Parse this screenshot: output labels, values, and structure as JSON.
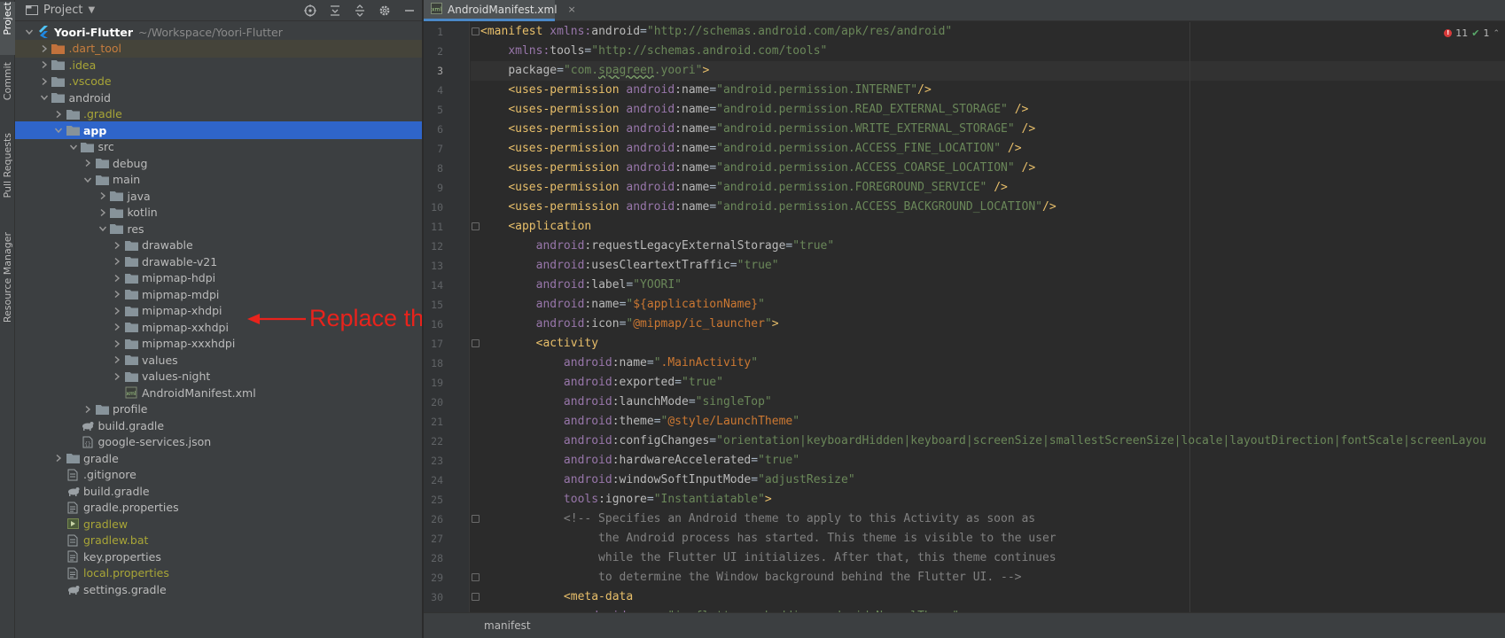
{
  "tool_strip": {
    "tabs": [
      {
        "label": "Project",
        "active": true
      },
      {
        "label": "Commit",
        "active": false
      },
      {
        "label": "Pull Requests",
        "active": false
      },
      {
        "label": "Resource Manager",
        "active": false
      }
    ]
  },
  "project_panel": {
    "title": "Project",
    "tools": [
      "locate-icon",
      "expand-all-icon",
      "collapse-all-icon",
      "settings-icon",
      "hide-icon"
    ],
    "tree": [
      {
        "label": "Yoori-Flutter",
        "sub": "~/Workspace/Yoori-Flutter",
        "depth": 0,
        "arrow": "down",
        "icon": "flutter-module-icon",
        "style": "bold"
      },
      {
        "label": ".dart_tool",
        "depth": 1,
        "arrow": "right",
        "icon": "excluded-folder-icon",
        "style": "orange",
        "dim": true
      },
      {
        "label": ".idea",
        "depth": 1,
        "arrow": "right",
        "icon": "folder-icon",
        "style": "olive"
      },
      {
        "label": ".vscode",
        "depth": 1,
        "arrow": "right",
        "icon": "folder-icon",
        "style": "olive"
      },
      {
        "label": "android",
        "depth": 1,
        "arrow": "down",
        "icon": "folder-icon",
        "style": "normal"
      },
      {
        "label": ".gradle",
        "depth": 2,
        "arrow": "right",
        "icon": "folder-icon",
        "style": "olive"
      },
      {
        "label": "app",
        "depth": 2,
        "arrow": "down",
        "icon": "folder-icon",
        "style": "normal",
        "selected": true
      },
      {
        "label": "src",
        "depth": 3,
        "arrow": "down",
        "icon": "folder-icon",
        "style": "normal"
      },
      {
        "label": "debug",
        "depth": 4,
        "arrow": "right",
        "icon": "folder-icon",
        "style": "normal"
      },
      {
        "label": "main",
        "depth": 4,
        "arrow": "down",
        "icon": "folder-icon",
        "style": "normal"
      },
      {
        "label": "java",
        "depth": 5,
        "arrow": "right",
        "icon": "folder-icon",
        "style": "normal"
      },
      {
        "label": "kotlin",
        "depth": 5,
        "arrow": "right",
        "icon": "folder-icon",
        "style": "normal"
      },
      {
        "label": "res",
        "depth": 5,
        "arrow": "down",
        "icon": "folder-icon",
        "style": "normal"
      },
      {
        "label": "drawable",
        "depth": 6,
        "arrow": "right",
        "icon": "folder-icon",
        "style": "normal"
      },
      {
        "label": "drawable-v21",
        "depth": 6,
        "arrow": "right",
        "icon": "folder-icon",
        "style": "normal"
      },
      {
        "label": "mipmap-hdpi",
        "depth": 6,
        "arrow": "right",
        "icon": "folder-icon",
        "style": "normal"
      },
      {
        "label": "mipmap-mdpi",
        "depth": 6,
        "arrow": "right",
        "icon": "folder-icon",
        "style": "normal"
      },
      {
        "label": "mipmap-xhdpi",
        "depth": 6,
        "arrow": "right",
        "icon": "folder-icon",
        "style": "normal"
      },
      {
        "label": "mipmap-xxhdpi",
        "depth": 6,
        "arrow": "right",
        "icon": "folder-icon",
        "style": "normal"
      },
      {
        "label": "mipmap-xxxhdpi",
        "depth": 6,
        "arrow": "right",
        "icon": "folder-icon",
        "style": "normal"
      },
      {
        "label": "values",
        "depth": 6,
        "arrow": "right",
        "icon": "folder-icon",
        "style": "normal"
      },
      {
        "label": "values-night",
        "depth": 6,
        "arrow": "right",
        "icon": "folder-icon",
        "style": "normal"
      },
      {
        "label": "AndroidManifest.xml",
        "depth": 6,
        "arrow": "none",
        "icon": "xml-file-icon",
        "style": "normal"
      },
      {
        "label": "profile",
        "depth": 4,
        "arrow": "right",
        "icon": "folder-icon",
        "style": "normal"
      },
      {
        "label": "build.gradle",
        "depth": 3,
        "arrow": "none",
        "icon": "gradle-file-icon",
        "style": "normal"
      },
      {
        "label": "google-services.json",
        "depth": 3,
        "arrow": "none",
        "icon": "json-file-icon",
        "style": "normal"
      },
      {
        "label": "gradle",
        "depth": 2,
        "arrow": "right",
        "icon": "folder-icon",
        "style": "normal"
      },
      {
        "label": ".gitignore",
        "depth": 2,
        "arrow": "none",
        "icon": "text-file-icon",
        "style": "normal"
      },
      {
        "label": "build.gradle",
        "depth": 2,
        "arrow": "none",
        "icon": "gradle-file-icon",
        "style": "normal"
      },
      {
        "label": "gradle.properties",
        "depth": 2,
        "arrow": "none",
        "icon": "properties-file-icon",
        "style": "normal"
      },
      {
        "label": "gradlew",
        "depth": 2,
        "arrow": "none",
        "icon": "script-file-icon",
        "style": "olive"
      },
      {
        "label": "gradlew.bat",
        "depth": 2,
        "arrow": "none",
        "icon": "text-file-icon",
        "style": "olive"
      },
      {
        "label": "key.properties",
        "depth": 2,
        "arrow": "none",
        "icon": "properties-file-icon",
        "style": "normal"
      },
      {
        "label": "local.properties",
        "depth": 2,
        "arrow": "none",
        "icon": "properties-file-icon",
        "style": "olive"
      },
      {
        "label": "settings.gradle",
        "depth": 2,
        "arrow": "none",
        "icon": "gradle-file-icon",
        "style": "normal"
      }
    ]
  },
  "annotation": {
    "text": "Replace these filese",
    "color": "#e8231c"
  },
  "editor": {
    "tab": {
      "name": "AndroidManifest.xml",
      "close": "×"
    },
    "inspections": {
      "errors": "11",
      "ok": "1"
    },
    "current_line": 3,
    "breadcrumb": "manifest",
    "lines": [
      {
        "n": 1,
        "fold": true,
        "tokens": [
          [
            "t-tag",
            "<manifest "
          ],
          [
            "t-ns",
            "xmlns:"
          ],
          [
            "t-attr",
            "android"
          ],
          [
            "t-plain",
            "="
          ],
          [
            "t-val",
            "\"http://schemas.android.com/apk/res/android\""
          ]
        ]
      },
      {
        "n": 2,
        "tokens": [
          [
            "t-plain",
            "    "
          ],
          [
            "t-ns",
            "xmlns:"
          ],
          [
            "t-attr",
            "tools"
          ],
          [
            "t-plain",
            "="
          ],
          [
            "t-val",
            "\"http://schemas.android.com/tools\""
          ]
        ]
      },
      {
        "n": 3,
        "tokens": [
          [
            "t-plain",
            "    "
          ],
          [
            "t-attr",
            "package"
          ],
          [
            "t-plain",
            "="
          ],
          [
            "t-val",
            "\"com."
          ],
          [
            "t-val squig",
            "spagreen"
          ],
          [
            "t-val",
            ".yoori\""
          ],
          [
            "t-tag",
            ">"
          ]
        ]
      },
      {
        "n": 4,
        "tokens": [
          [
            "t-plain",
            "    "
          ],
          [
            "t-tag",
            "<uses-permission "
          ],
          [
            "t-ns",
            "android"
          ],
          [
            "t-attr",
            ":name"
          ],
          [
            "t-plain",
            "="
          ],
          [
            "t-val",
            "\"android.permission.INTERNET\""
          ],
          [
            "t-tag",
            "/>"
          ]
        ]
      },
      {
        "n": 5,
        "tokens": [
          [
            "t-plain",
            "    "
          ],
          [
            "t-tag",
            "<uses-permission "
          ],
          [
            "t-ns",
            "android"
          ],
          [
            "t-attr",
            ":name"
          ],
          [
            "t-plain",
            "="
          ],
          [
            "t-val",
            "\"android.permission.READ_EXTERNAL_STORAGE\""
          ],
          [
            "t-tag",
            " />"
          ]
        ]
      },
      {
        "n": 6,
        "tokens": [
          [
            "t-plain",
            "    "
          ],
          [
            "t-tag",
            "<uses-permission "
          ],
          [
            "t-ns",
            "android"
          ],
          [
            "t-attr",
            ":name"
          ],
          [
            "t-plain",
            "="
          ],
          [
            "t-val",
            "\"android.permission.WRITE_EXTERNAL_STORAGE\""
          ],
          [
            "t-tag",
            " />"
          ]
        ]
      },
      {
        "n": 7,
        "tokens": [
          [
            "t-plain",
            "    "
          ],
          [
            "t-tag",
            "<uses-permission "
          ],
          [
            "t-ns",
            "android"
          ],
          [
            "t-attr",
            ":name"
          ],
          [
            "t-plain",
            "="
          ],
          [
            "t-val",
            "\"android.permission.ACCESS_FINE_LOCATION\""
          ],
          [
            "t-tag",
            " />"
          ]
        ]
      },
      {
        "n": 8,
        "tokens": [
          [
            "t-plain",
            "    "
          ],
          [
            "t-tag",
            "<uses-permission "
          ],
          [
            "t-ns",
            "android"
          ],
          [
            "t-attr",
            ":name"
          ],
          [
            "t-plain",
            "="
          ],
          [
            "t-val",
            "\"android.permission.ACCESS_COARSE_LOCATION\""
          ],
          [
            "t-tag",
            " />"
          ]
        ]
      },
      {
        "n": 9,
        "tokens": [
          [
            "t-plain",
            "    "
          ],
          [
            "t-tag",
            "<uses-permission "
          ],
          [
            "t-ns",
            "android"
          ],
          [
            "t-attr",
            ":name"
          ],
          [
            "t-plain",
            "="
          ],
          [
            "t-val",
            "\"android.permission.FOREGROUND_SERVICE\""
          ],
          [
            "t-tag",
            " />"
          ]
        ]
      },
      {
        "n": 10,
        "tokens": [
          [
            "t-plain",
            "    "
          ],
          [
            "t-tag",
            "<uses-permission "
          ],
          [
            "t-ns",
            "android"
          ],
          [
            "t-attr",
            ":name"
          ],
          [
            "t-plain",
            "="
          ],
          [
            "t-val",
            "\"android.permission.ACCESS_BACKGROUND_LOCATION\""
          ],
          [
            "t-tag",
            "/>"
          ]
        ]
      },
      {
        "n": 11,
        "fold": true,
        "tokens": [
          [
            "t-plain",
            "    "
          ],
          [
            "t-tag",
            "<application"
          ]
        ]
      },
      {
        "n": 12,
        "tokens": [
          [
            "t-plain",
            "        "
          ],
          [
            "t-ns",
            "android"
          ],
          [
            "t-attr",
            ":requestLegacyExternalStorage"
          ],
          [
            "t-plain",
            "="
          ],
          [
            "t-val",
            "\"true\""
          ]
        ]
      },
      {
        "n": 13,
        "tokens": [
          [
            "t-plain",
            "        "
          ],
          [
            "t-ns",
            "android"
          ],
          [
            "t-attr",
            ":usesCleartextTraffic"
          ],
          [
            "t-plain",
            "="
          ],
          [
            "t-val",
            "\"true\""
          ]
        ]
      },
      {
        "n": 14,
        "tokens": [
          [
            "t-plain",
            "        "
          ],
          [
            "t-ns",
            "android"
          ],
          [
            "t-attr",
            ":label"
          ],
          [
            "t-plain",
            "="
          ],
          [
            "t-val",
            "\"YOORI\""
          ]
        ]
      },
      {
        "n": 15,
        "tokens": [
          [
            "t-plain",
            "        "
          ],
          [
            "t-ns",
            "android"
          ],
          [
            "t-attr",
            ":name"
          ],
          [
            "t-plain",
            "="
          ],
          [
            "t-val",
            "\""
          ],
          [
            "t-ref",
            "${applicationName}"
          ],
          [
            "t-val",
            "\""
          ]
        ]
      },
      {
        "n": 16,
        "tokens": [
          [
            "t-plain",
            "        "
          ],
          [
            "t-ns",
            "android"
          ],
          [
            "t-attr",
            ":icon"
          ],
          [
            "t-plain",
            "="
          ],
          [
            "t-val",
            "\""
          ],
          [
            "t-ref",
            "@mipmap/ic_launcher"
          ],
          [
            "t-val",
            "\""
          ],
          [
            "t-tag",
            ">"
          ]
        ]
      },
      {
        "n": 17,
        "fold": true,
        "tokens": [
          [
            "t-plain",
            "        "
          ],
          [
            "t-tag",
            "<activity"
          ]
        ]
      },
      {
        "n": 18,
        "tokens": [
          [
            "t-plain",
            "            "
          ],
          [
            "t-ns",
            "android"
          ],
          [
            "t-attr",
            ":name"
          ],
          [
            "t-plain",
            "="
          ],
          [
            "t-val",
            "\""
          ],
          [
            "t-ref",
            ".MainActivity"
          ],
          [
            "t-val",
            "\""
          ]
        ]
      },
      {
        "n": 19,
        "tokens": [
          [
            "t-plain",
            "            "
          ],
          [
            "t-ns",
            "android"
          ],
          [
            "t-attr",
            ":exported"
          ],
          [
            "t-plain",
            "="
          ],
          [
            "t-val",
            "\"true\""
          ]
        ]
      },
      {
        "n": 20,
        "tokens": [
          [
            "t-plain",
            "            "
          ],
          [
            "t-ns",
            "android"
          ],
          [
            "t-attr",
            ":launchMode"
          ],
          [
            "t-plain",
            "="
          ],
          [
            "t-val",
            "\"singleTop\""
          ]
        ]
      },
      {
        "n": 21,
        "tokens": [
          [
            "t-plain",
            "            "
          ],
          [
            "t-ns",
            "android"
          ],
          [
            "t-attr",
            ":theme"
          ],
          [
            "t-plain",
            "="
          ],
          [
            "t-val",
            "\""
          ],
          [
            "t-ref",
            "@style/LaunchTheme"
          ],
          [
            "t-val",
            "\""
          ]
        ]
      },
      {
        "n": 22,
        "tokens": [
          [
            "t-plain",
            "            "
          ],
          [
            "t-ns",
            "android"
          ],
          [
            "t-attr",
            ":configChanges"
          ],
          [
            "t-plain",
            "="
          ],
          [
            "t-val",
            "\"orientation|keyboardHidden|keyboard|screenSize|smallestScreenSize|locale|layoutDirection|fontScale|screenLayou"
          ]
        ]
      },
      {
        "n": 23,
        "tokens": [
          [
            "t-plain",
            "            "
          ],
          [
            "t-ns",
            "android"
          ],
          [
            "t-attr",
            ":hardwareAccelerated"
          ],
          [
            "t-plain",
            "="
          ],
          [
            "t-val",
            "\"true\""
          ]
        ]
      },
      {
        "n": 24,
        "tokens": [
          [
            "t-plain",
            "            "
          ],
          [
            "t-ns",
            "android"
          ],
          [
            "t-attr",
            ":windowSoftInputMode"
          ],
          [
            "t-plain",
            "="
          ],
          [
            "t-val",
            "\"adjustResize\""
          ]
        ]
      },
      {
        "n": 25,
        "tokens": [
          [
            "t-plain",
            "            "
          ],
          [
            "t-ns",
            "tools"
          ],
          [
            "t-attr",
            ":ignore"
          ],
          [
            "t-plain",
            "="
          ],
          [
            "t-val",
            "\"Instantiatable\""
          ],
          [
            "t-tag",
            ">"
          ]
        ]
      },
      {
        "n": 26,
        "fold": true,
        "tokens": [
          [
            "t-plain",
            "            "
          ],
          [
            "t-cmt",
            "<!-- Specifies an Android theme to apply to this Activity as soon as"
          ]
        ]
      },
      {
        "n": 27,
        "tokens": [
          [
            "t-cmt",
            "                 the Android process has started. This theme is visible to the user"
          ]
        ]
      },
      {
        "n": 28,
        "tokens": [
          [
            "t-cmt",
            "                 while the Flutter UI initializes. After that, this theme continues"
          ]
        ]
      },
      {
        "n": 29,
        "fold": true,
        "tokens": [
          [
            "t-cmt",
            "                 to determine the Window background behind the Flutter UI. -->"
          ]
        ]
      },
      {
        "n": 30,
        "fold": true,
        "tokens": [
          [
            "t-plain",
            "            "
          ],
          [
            "t-tag",
            "<meta-data"
          ]
        ]
      },
      {
        "n": 31,
        "tokens": [
          [
            "t-plain",
            "              "
          ],
          [
            "t-ns",
            "android"
          ],
          [
            "t-attr",
            ":name"
          ],
          [
            "t-plain",
            "="
          ],
          [
            "t-val",
            "\"io.flutter.embedding.android.NormalTheme\""
          ]
        ]
      }
    ]
  }
}
